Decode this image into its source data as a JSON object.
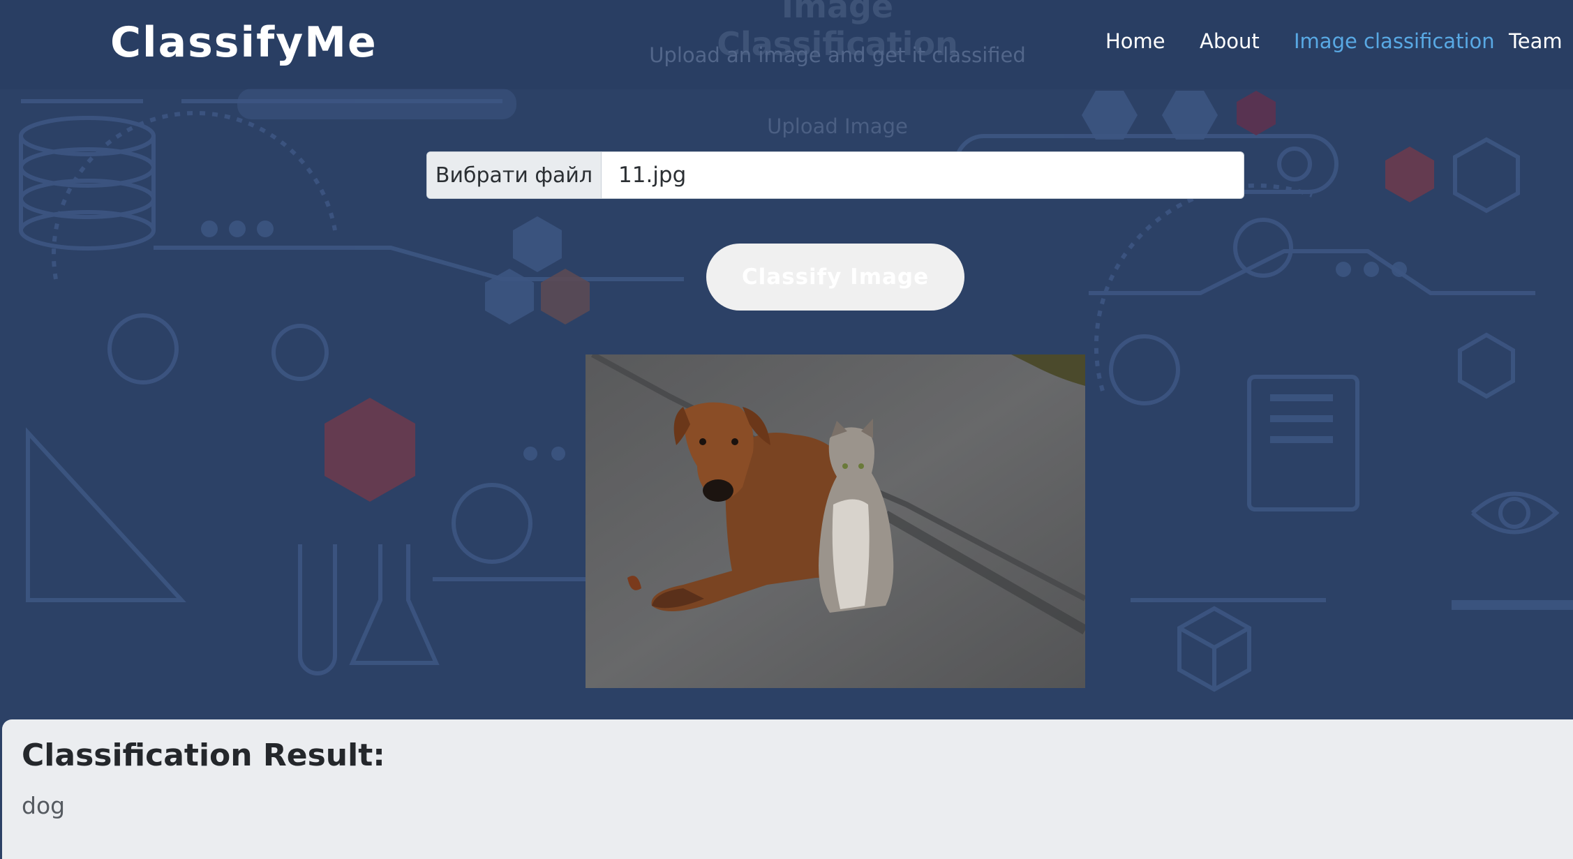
{
  "brand": "ClassifyMe",
  "page": {
    "title": "Image Classification",
    "subtitle": "Upload an image and get it classified"
  },
  "nav": {
    "items": [
      {
        "label": "Home",
        "active": false
      },
      {
        "label": "About",
        "active": false
      },
      {
        "label": "Image classification",
        "active": true
      },
      {
        "label": "Team",
        "active": false
      }
    ]
  },
  "upload": {
    "label": "Upload Image",
    "choose_file_label": "Вибрати файл",
    "file_name": "11.jpg"
  },
  "classify_button": "Classify Image",
  "preview_image": {
    "subject": "dog and cat on pavement"
  },
  "result": {
    "title": "Classification Result:",
    "value": "dog"
  },
  "colors": {
    "background": "#2c4166",
    "nav_active": "#59a9e4",
    "result_panel": "#ebedf0"
  }
}
